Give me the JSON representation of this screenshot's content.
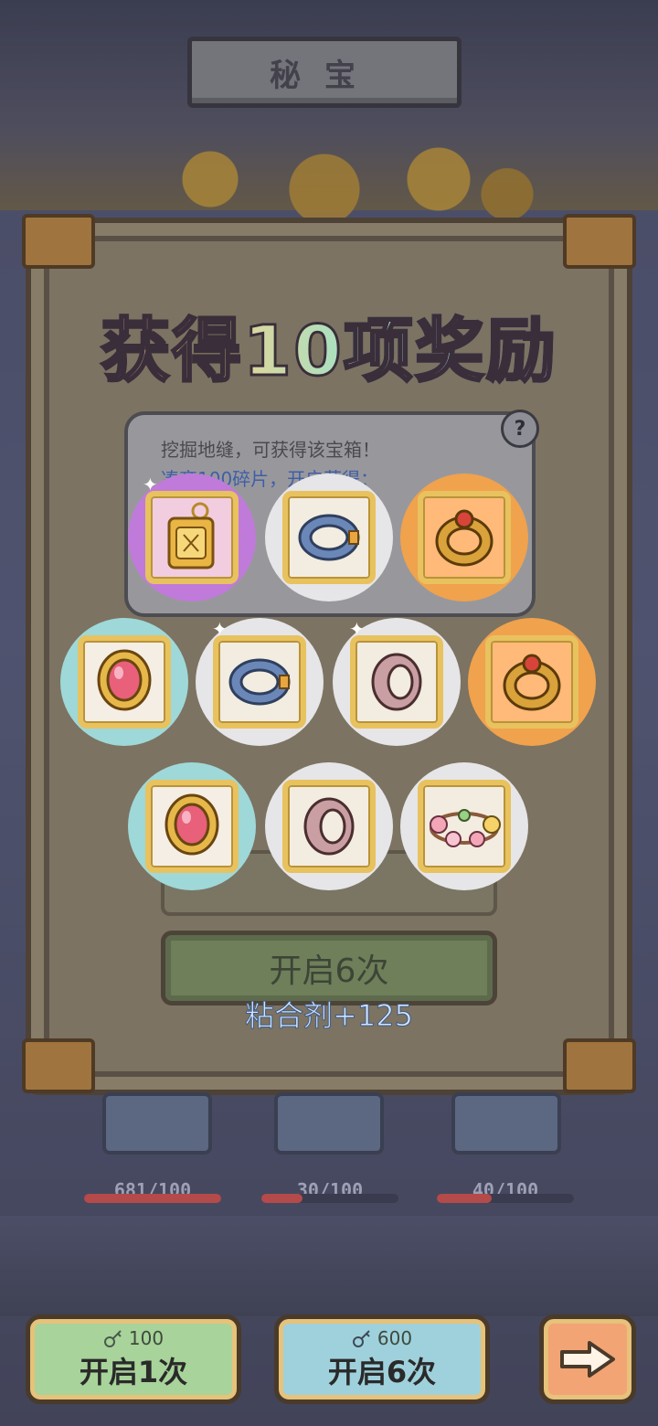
{
  "screen": {
    "title": "秘宝",
    "headline": "获得10项奖励"
  },
  "hint": {
    "line1": "挖掘地缝，可获得该宝箱！",
    "line2": "凑齐100碎片，开启获得："
  },
  "dialog": {
    "faded_button_label": "开启6次",
    "reward_caption": "粘合剂+125"
  },
  "rewards": [
    {
      "name": "golden-amulet",
      "rarity": "purple"
    },
    {
      "name": "blue-ring",
      "rarity": "white"
    },
    {
      "name": "golden-ruby-ring",
      "rarity": "orange"
    },
    {
      "name": "ruby-brooch",
      "rarity": "teal"
    },
    {
      "name": "blue-ring",
      "rarity": "white"
    },
    {
      "name": "pink-ring",
      "rarity": "white"
    },
    {
      "name": "golden-ruby-ring",
      "rarity": "orange"
    },
    {
      "name": "ruby-brooch",
      "rarity": "teal"
    },
    {
      "name": "pink-ring",
      "rarity": "white"
    },
    {
      "name": "flower-crown",
      "rarity": "white"
    }
  ],
  "progress": [
    {
      "label": "681/100",
      "value": 681,
      "max": 100
    },
    {
      "label": "30/100",
      "value": 30,
      "max": 100
    },
    {
      "label": "40/100",
      "value": 40,
      "max": 100
    }
  ],
  "buttons": {
    "open_once": {
      "cost": "100",
      "label": "开启1次"
    },
    "open_six": {
      "cost": "600",
      "label": "开启6次"
    },
    "next": {
      "icon": "arrow-right-icon"
    }
  },
  "colors": {
    "rarity_white": "#e6e5e8",
    "rarity_purple": "#c07ad9",
    "rarity_orange": "#f0a24d",
    "rarity_teal": "#9fd8d8",
    "button_green": "#a8d39a",
    "button_blue": "#9fd1dc",
    "button_orange": "#f2a474"
  }
}
